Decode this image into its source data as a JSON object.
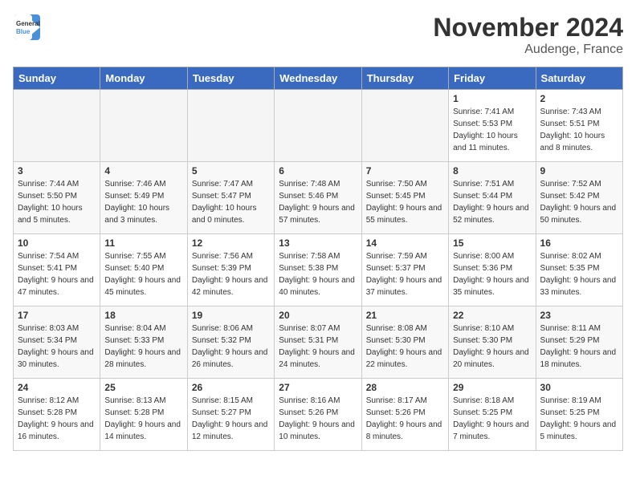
{
  "header": {
    "logo_line1": "General",
    "logo_line2": "Blue",
    "month": "November 2024",
    "location": "Audenge, France"
  },
  "days_of_week": [
    "Sunday",
    "Monday",
    "Tuesday",
    "Wednesday",
    "Thursday",
    "Friday",
    "Saturday"
  ],
  "weeks": [
    [
      {
        "day": null,
        "info": null
      },
      {
        "day": null,
        "info": null
      },
      {
        "day": null,
        "info": null
      },
      {
        "day": null,
        "info": null
      },
      {
        "day": null,
        "info": null
      },
      {
        "day": "1",
        "info": "Sunrise: 7:41 AM\nSunset: 5:53 PM\nDaylight: 10 hours and 11 minutes."
      },
      {
        "day": "2",
        "info": "Sunrise: 7:43 AM\nSunset: 5:51 PM\nDaylight: 10 hours and 8 minutes."
      }
    ],
    [
      {
        "day": "3",
        "info": "Sunrise: 7:44 AM\nSunset: 5:50 PM\nDaylight: 10 hours and 5 minutes."
      },
      {
        "day": "4",
        "info": "Sunrise: 7:46 AM\nSunset: 5:49 PM\nDaylight: 10 hours and 3 minutes."
      },
      {
        "day": "5",
        "info": "Sunrise: 7:47 AM\nSunset: 5:47 PM\nDaylight: 10 hours and 0 minutes."
      },
      {
        "day": "6",
        "info": "Sunrise: 7:48 AM\nSunset: 5:46 PM\nDaylight: 9 hours and 57 minutes."
      },
      {
        "day": "7",
        "info": "Sunrise: 7:50 AM\nSunset: 5:45 PM\nDaylight: 9 hours and 55 minutes."
      },
      {
        "day": "8",
        "info": "Sunrise: 7:51 AM\nSunset: 5:44 PM\nDaylight: 9 hours and 52 minutes."
      },
      {
        "day": "9",
        "info": "Sunrise: 7:52 AM\nSunset: 5:42 PM\nDaylight: 9 hours and 50 minutes."
      }
    ],
    [
      {
        "day": "10",
        "info": "Sunrise: 7:54 AM\nSunset: 5:41 PM\nDaylight: 9 hours and 47 minutes."
      },
      {
        "day": "11",
        "info": "Sunrise: 7:55 AM\nSunset: 5:40 PM\nDaylight: 9 hours and 45 minutes."
      },
      {
        "day": "12",
        "info": "Sunrise: 7:56 AM\nSunset: 5:39 PM\nDaylight: 9 hours and 42 minutes."
      },
      {
        "day": "13",
        "info": "Sunrise: 7:58 AM\nSunset: 5:38 PM\nDaylight: 9 hours and 40 minutes."
      },
      {
        "day": "14",
        "info": "Sunrise: 7:59 AM\nSunset: 5:37 PM\nDaylight: 9 hours and 37 minutes."
      },
      {
        "day": "15",
        "info": "Sunrise: 8:00 AM\nSunset: 5:36 PM\nDaylight: 9 hours and 35 minutes."
      },
      {
        "day": "16",
        "info": "Sunrise: 8:02 AM\nSunset: 5:35 PM\nDaylight: 9 hours and 33 minutes."
      }
    ],
    [
      {
        "day": "17",
        "info": "Sunrise: 8:03 AM\nSunset: 5:34 PM\nDaylight: 9 hours and 30 minutes."
      },
      {
        "day": "18",
        "info": "Sunrise: 8:04 AM\nSunset: 5:33 PM\nDaylight: 9 hours and 28 minutes."
      },
      {
        "day": "19",
        "info": "Sunrise: 8:06 AM\nSunset: 5:32 PM\nDaylight: 9 hours and 26 minutes."
      },
      {
        "day": "20",
        "info": "Sunrise: 8:07 AM\nSunset: 5:31 PM\nDaylight: 9 hours and 24 minutes."
      },
      {
        "day": "21",
        "info": "Sunrise: 8:08 AM\nSunset: 5:30 PM\nDaylight: 9 hours and 22 minutes."
      },
      {
        "day": "22",
        "info": "Sunrise: 8:10 AM\nSunset: 5:30 PM\nDaylight: 9 hours and 20 minutes."
      },
      {
        "day": "23",
        "info": "Sunrise: 8:11 AM\nSunset: 5:29 PM\nDaylight: 9 hours and 18 minutes."
      }
    ],
    [
      {
        "day": "24",
        "info": "Sunrise: 8:12 AM\nSunset: 5:28 PM\nDaylight: 9 hours and 16 minutes."
      },
      {
        "day": "25",
        "info": "Sunrise: 8:13 AM\nSunset: 5:28 PM\nDaylight: 9 hours and 14 minutes."
      },
      {
        "day": "26",
        "info": "Sunrise: 8:15 AM\nSunset: 5:27 PM\nDaylight: 9 hours and 12 minutes."
      },
      {
        "day": "27",
        "info": "Sunrise: 8:16 AM\nSunset: 5:26 PM\nDaylight: 9 hours and 10 minutes."
      },
      {
        "day": "28",
        "info": "Sunrise: 8:17 AM\nSunset: 5:26 PM\nDaylight: 9 hours and 8 minutes."
      },
      {
        "day": "29",
        "info": "Sunrise: 8:18 AM\nSunset: 5:25 PM\nDaylight: 9 hours and 7 minutes."
      },
      {
        "day": "30",
        "info": "Sunrise: 8:19 AM\nSunset: 5:25 PM\nDaylight: 9 hours and 5 minutes."
      }
    ]
  ]
}
